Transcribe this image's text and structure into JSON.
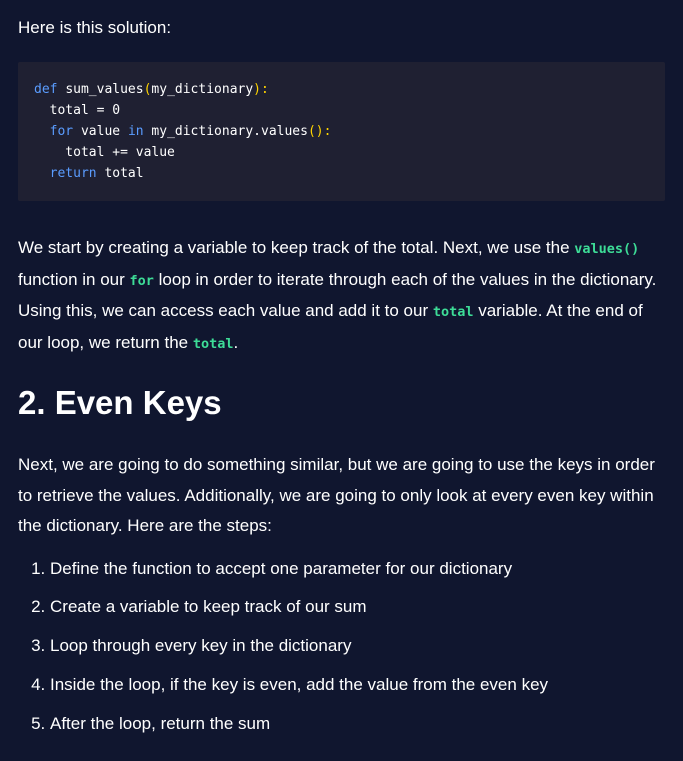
{
  "intro_text": "Here is this solution:",
  "code": {
    "lines": [
      [
        {
          "t": "def ",
          "c": "kw"
        },
        {
          "t": "sum_values",
          "c": "plain"
        },
        {
          "t": "(",
          "c": "paren"
        },
        {
          "t": "my_dictionary",
          "c": "plain"
        },
        {
          "t": "):",
          "c": "paren"
        }
      ],
      [
        {
          "t": "  total = 0",
          "c": "plain"
        }
      ],
      [
        {
          "t": "  ",
          "c": "plain"
        },
        {
          "t": "for ",
          "c": "kw"
        },
        {
          "t": "value ",
          "c": "plain"
        },
        {
          "t": "in ",
          "c": "kw"
        },
        {
          "t": "my_dictionary.values",
          "c": "plain"
        },
        {
          "t": "():",
          "c": "paren"
        }
      ],
      [
        {
          "t": "    total += value",
          "c": "plain"
        }
      ],
      [
        {
          "t": "  ",
          "c": "plain"
        },
        {
          "t": "return ",
          "c": "kw"
        },
        {
          "t": "total",
          "c": "plain"
        }
      ]
    ]
  },
  "para1": {
    "s1": "We start by creating a variable to keep track of the total. Next, we use the ",
    "c1": "values()",
    "s2": " function in our ",
    "c2": "for",
    "s3": " loop in order to iterate through each of the values in the dictionary. Using this, we can access each value and add it to our ",
    "c3": "total",
    "s4": " variable. At the end of our loop, we return the ",
    "c4": "total",
    "s5": "."
  },
  "heading": "2. Even Keys",
  "para2": "Next, we are going to do something similar, but we are going to use the keys in order to retrieve the values. Additionally, we are going to only look at every even key within the dictionary. Here are the steps:",
  "steps": [
    "Define the function to accept one parameter for our dictionary",
    "Create a variable to keep track of our sum",
    "Loop through every key in the dictionary",
    "Inside the loop, if the key is even, add the value from the even key",
    "After the loop, return the sum"
  ],
  "colors": {
    "background": "#10162f",
    "code_background": "#1f2032",
    "keyword": "#5a9cff",
    "bracket": "#ffd400",
    "inline_code": "#3ddc97"
  }
}
